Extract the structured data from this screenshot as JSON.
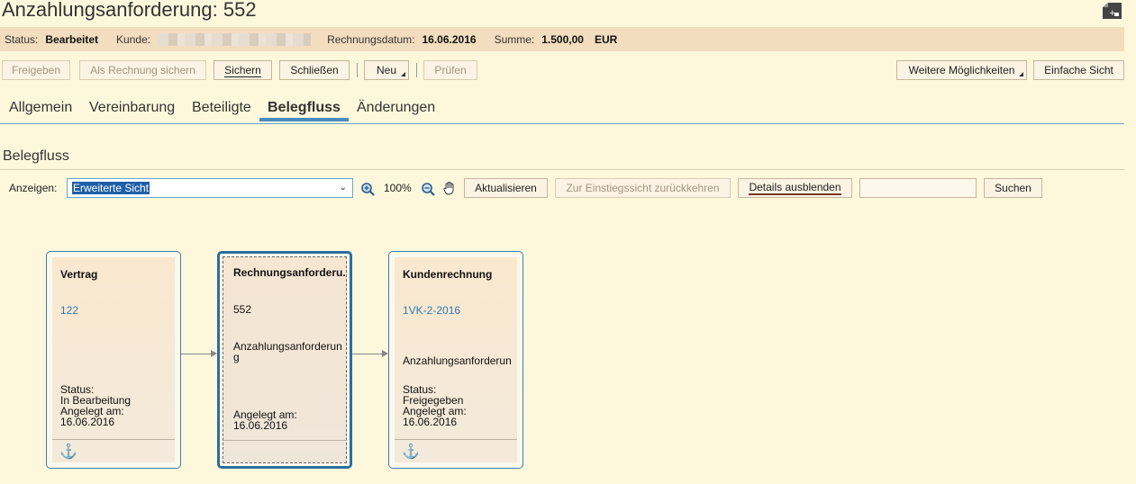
{
  "header": {
    "title": "Anzahlungsanforderung: 552"
  },
  "infobar": {
    "status_label": "Status:",
    "status_value": "Bearbeitet",
    "customer_label": "Kunde:",
    "date_label": "Rechnungsdatum:",
    "date_value": "16.06.2016",
    "sum_label": "Summe:",
    "sum_value": "1.500,00",
    "currency": "EUR"
  },
  "toolbar": {
    "freigeben": "Freigeben",
    "als_rechnung": "Als Rechnung sichern",
    "sichern": "Sichern",
    "schliessen": "Schließen",
    "neu": "Neu",
    "pruefen": "Prüfen",
    "weitere": "Weitere Möglichkeiten",
    "einfache_sicht": "Einfache Sicht"
  },
  "tabs": [
    "Allgemein",
    "Vereinbarung",
    "Beteiligte",
    "Belegfluss",
    "Änderungen"
  ],
  "section": {
    "title": "Belegfluss",
    "anzeigen_label": "Anzeigen:",
    "view_selected": "Erweiterte Sicht",
    "zoom": "100%",
    "aktualisieren": "Aktualisieren",
    "zurueck": "Zur Einstiegssicht zurückkehren",
    "details": "Details ausblenden",
    "suchen": "Suchen"
  },
  "cards": [
    {
      "title": "Vertrag",
      "link": "122",
      "status_label": "Status:",
      "status": "In Bearbeitung",
      "created_label": "Angelegt am:",
      "created": "16.06.2016"
    },
    {
      "title": "Rechnungsanforderu.",
      "number": "552",
      "type_line1": "Anzahlungsanforderun",
      "type_line2": "g",
      "created_label": "Angelegt am:",
      "created": "16.06.2016"
    },
    {
      "title": "Kundenrechnung",
      "link": "1VK-2-2016",
      "type": "Anzahlungsanforderun",
      "status_label": "Status:",
      "status": "Freigegeben",
      "created_label": "Angelegt am:",
      "created": "16.06.2016"
    }
  ],
  "icons": {
    "zoom_in": "zoom-in-icon",
    "zoom_out": "zoom-out-icon",
    "pan": "hand-icon",
    "anchor": "anchor-icon",
    "new_window": "new-window-icon"
  }
}
